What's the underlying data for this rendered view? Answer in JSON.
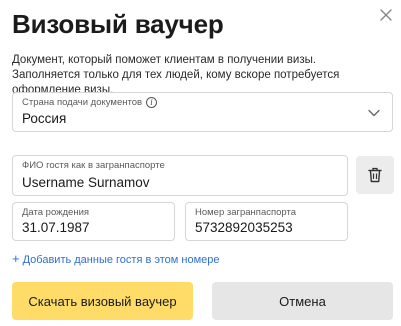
{
  "dialog": {
    "title": "Визовый ваучер",
    "description": "Документ, который поможет клиентам в получении визы. Заполняется только для тех людей, кому вскоре потребуется оформление визы."
  },
  "country": {
    "label": "Страна подачи документов",
    "value": "Россия"
  },
  "guest": {
    "name_label": "ФИО гостя как в загранпаспорте",
    "name_value": "Username Surnamov",
    "birth_label": "Дата рождения",
    "birth_value": "31.07.1987",
    "passport_label": "Номер загранпаспорта",
    "passport_value": "5732892035253"
  },
  "add_guest_link": "Добавить данные гостя в этом номере",
  "buttons": {
    "primary": "Скачать визовый ваучер",
    "cancel": "Отмена"
  },
  "colors": {
    "primary_button": "#fedc67",
    "secondary_button": "#e6e6e6",
    "link": "#2f6fd0"
  },
  "icons": [
    "close-icon",
    "info-icon",
    "chevron-down-icon",
    "trash-icon",
    "plus-icon"
  ]
}
